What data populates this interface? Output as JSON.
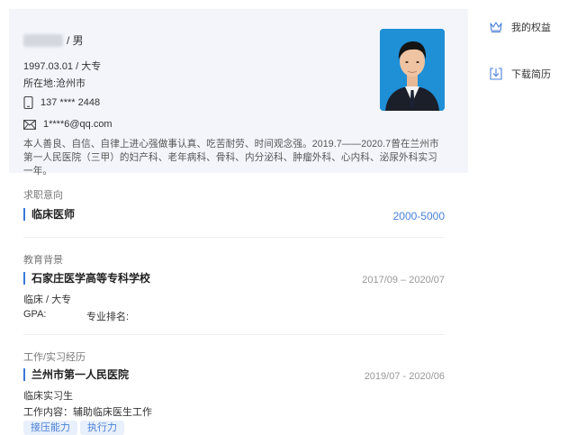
{
  "profile": {
    "gender": "/ 男",
    "birth_edu": "1997.03.01 / 大专",
    "location": "所在地:沧州市",
    "phone": "137 **** 2448",
    "email": "1****6@qq.com",
    "bio": "本人善良、自信、自律上进心强做事认真、吃苦耐劳、时间观念强。2019.7——2020.7曾在兰州市第一人民医院（三甲）的妇产科、老年病科、骨科、内分泌科、肿瘤外科、心内科、泌尿外科实习一年。"
  },
  "sidebar": {
    "rights_label": "我的权益",
    "download_label": "下载简历"
  },
  "intent": {
    "section_title": "求职意向",
    "position": "临床医师",
    "salary": "2000-5000"
  },
  "education": {
    "section_title": "教育背景",
    "school": "石家庄医学高等专科学校",
    "period": "2017/09 – 2020/07",
    "major": "临床 / 大专",
    "gpa_label": "GPA:",
    "rank_label": "专业排名:"
  },
  "work": {
    "section_title": "工作/实习经历",
    "company": "兰州市第一人民医院",
    "period": "2019/07 - 2020/06",
    "role": "临床实习生",
    "content": "工作内容：辅助临床医生工作",
    "tags": [
      "接压能力",
      "执行力"
    ]
  },
  "colors": {
    "accent": "#3a78d8",
    "profile_bg": "#f3f5fb"
  }
}
